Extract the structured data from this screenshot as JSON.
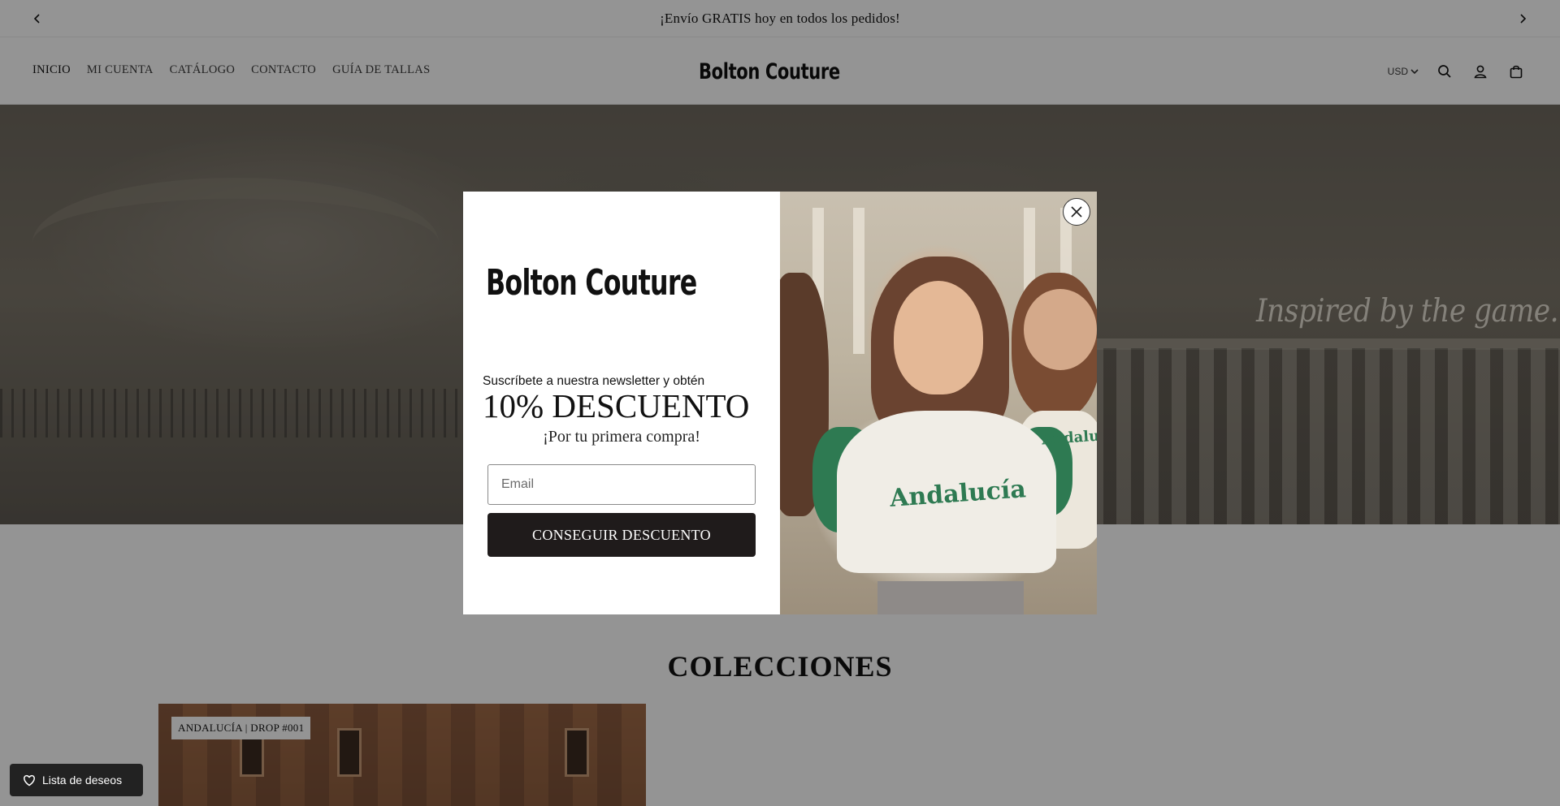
{
  "announcement": {
    "text": "¡Envío GRATIS hoy en todos los pedidos!",
    "prev_icon": "chevron-left-icon",
    "next_icon": "chevron-right-icon"
  },
  "header": {
    "nav": [
      "INICIO",
      "MI CUENTA",
      "CATÁLOGO",
      "CONTACTO",
      "GUÍA DE TALLAS"
    ],
    "brand": "Bolton Couture",
    "currency": "USD",
    "icons": [
      "search-icon",
      "account-icon",
      "cart-icon"
    ]
  },
  "hero": {
    "tagline": "Inspired by the game."
  },
  "collections": {
    "title": "COLECCIONES",
    "items": [
      {
        "badge": "ANDALUCÍA | DROP #001"
      }
    ]
  },
  "wishlist": {
    "label": "Lista de deseos",
    "icon": "heart-icon"
  },
  "popup": {
    "brand": "Bolton Couture",
    "subtitle": "Suscríbete a nuestra newsletter y obtén",
    "headline": "10% DESCUENTO",
    "first_purchase": "¡Por tu primera compra!",
    "email_placeholder": "Email",
    "button_label": "CONSEGUIR DESCUENTO",
    "shirt_text": "Andalucía",
    "shirt_text_2": "Andalucía",
    "close_icon": "close-icon"
  },
  "colors": {
    "dark_button": "#1f1b1b",
    "shirt_green": "#2e7a52",
    "overlay": "rgba(0,0,0,0.42)"
  }
}
